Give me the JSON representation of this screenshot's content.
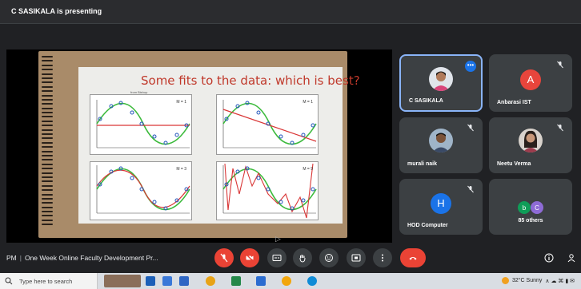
{
  "topbar": {
    "presenting_text": "C SASIKALA is presenting"
  },
  "slide": {
    "title": "Some fits to the data: which is best?",
    "plots": [
      {
        "label": "M = 1",
        "head": "from Bishop"
      },
      {
        "label": "M = 1",
        "head": ""
      },
      {
        "label": "M = 3",
        "head": ""
      },
      {
        "label": "M = 9",
        "head": ""
      }
    ]
  },
  "participants": [
    {
      "name": "C SASIKALA",
      "type": "photo",
      "active": true
    },
    {
      "name": "Anbarasi IST",
      "type": "letter",
      "letter": "A",
      "color": "#e8453c"
    },
    {
      "name": "murali naik",
      "type": "photo"
    },
    {
      "name": "Neetu Verma",
      "type": "photo"
    },
    {
      "name": "HOD Computer",
      "type": "letter",
      "letter": "H",
      "color": "#1a73e8"
    },
    {
      "name": "85 others",
      "type": "others",
      "letters": [
        "b",
        "C"
      ],
      "colors": [
        "#0f9d58",
        "#8e6bd6"
      ]
    }
  ],
  "controls": {
    "time_fragment": "PM",
    "meeting_title": "One Week Online Faculty Development Pr...",
    "accent": "#ea4335"
  },
  "taskbar": {
    "search_placeholder": "Type here to search",
    "weather": "32°C  Sunny"
  }
}
